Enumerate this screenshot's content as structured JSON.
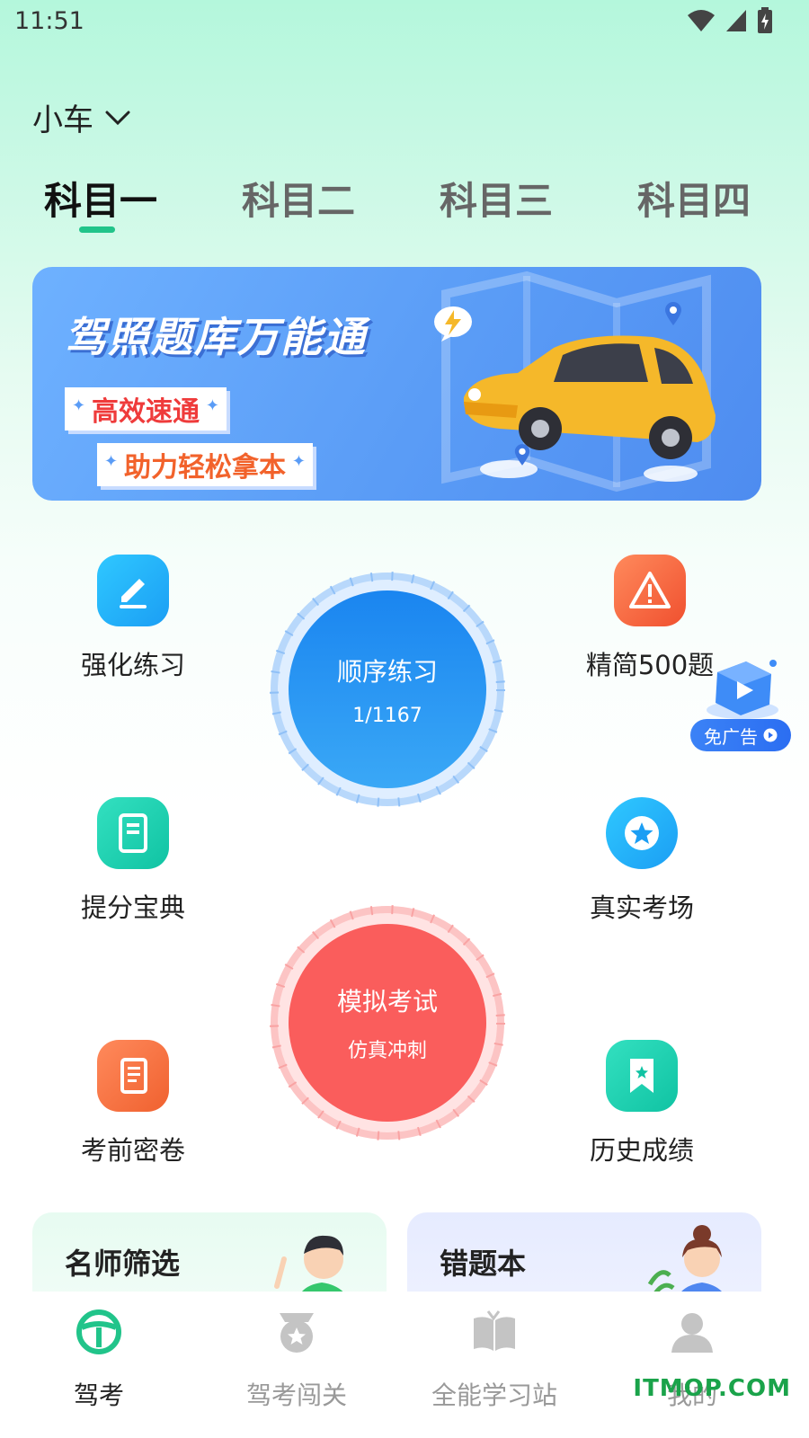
{
  "status_bar": {
    "time": "11:51"
  },
  "vehicle": {
    "label": "小车"
  },
  "tabs": [
    {
      "label": "科目一",
      "active": true
    },
    {
      "label": "科目二",
      "active": false
    },
    {
      "label": "科目三",
      "active": false
    },
    {
      "label": "科目四",
      "active": false
    }
  ],
  "banner": {
    "title": "驾照题库万能通",
    "tag1": "高效速通",
    "tag2": "助力轻松拿本"
  },
  "grid": {
    "qianghua": "强化练习",
    "jingjian": "精简500题",
    "tifen": "提分宝典",
    "zhenshi": "真实考场",
    "kaoqian": "考前密卷",
    "lishi": "历史成绩"
  },
  "sequential": {
    "title": "顺序练习",
    "progress": "1/1167"
  },
  "mock_exam": {
    "title": "模拟考试",
    "subtitle": "仿真冲刺"
  },
  "ad": {
    "label": "免广告"
  },
  "cards": {
    "teacher": "名师筛选",
    "wrong": "错题本"
  },
  "nav": {
    "drive": "驾考",
    "challenge": "驾考闯关",
    "study": "全能学习站",
    "mine": "我的"
  },
  "watermark": "ITMOP.COM",
  "colors": {
    "accent": "#21c48a",
    "blue_circle": "#2b8ff3",
    "red_circle": "#fa5d5c"
  }
}
